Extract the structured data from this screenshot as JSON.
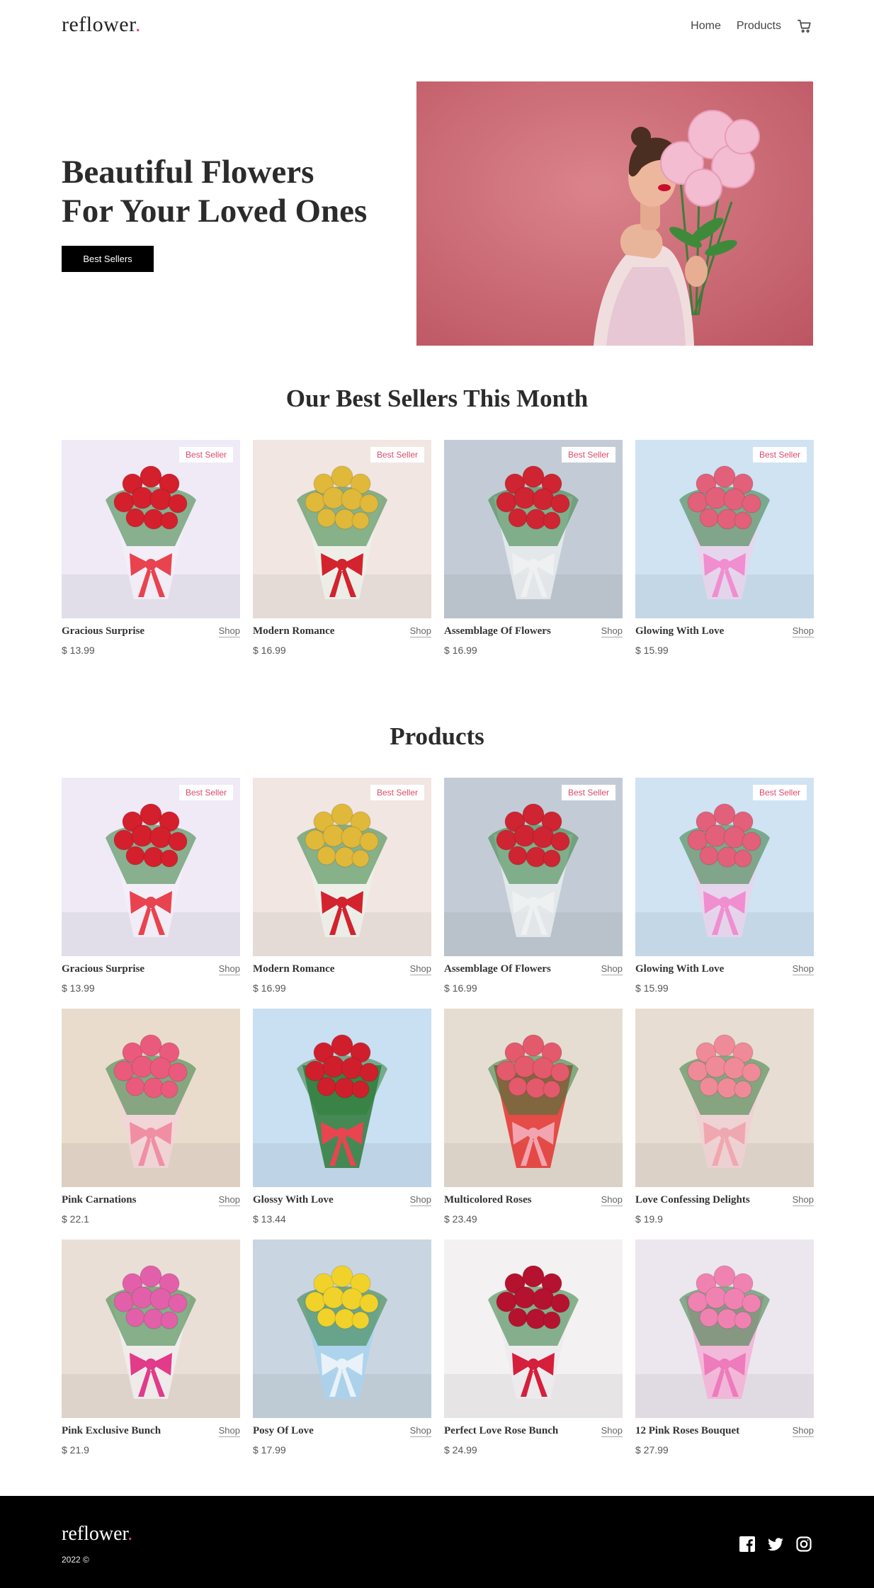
{
  "header": {
    "logo_text": "reflower",
    "logo_dot": ".",
    "nav": {
      "home": "Home",
      "products": "Products"
    }
  },
  "hero": {
    "title_line1": "Beautiful Flowers",
    "title_line2": "For Your Loved Ones",
    "button": "Best Sellers"
  },
  "best_sellers": {
    "title": "Our Best Sellers This Month",
    "items": [
      {
        "name": "Gracious Surprise",
        "price": "$ 13.99",
        "shop": "Shop",
        "badge": "Best Seller",
        "bg": "#efeaf6",
        "flower": "#d41f2c",
        "wrap": "#f3eef7",
        "ribbon": "#e8434f"
      },
      {
        "name": "Modern Romance",
        "price": "$ 16.99",
        "shop": "Shop",
        "badge": "Best Seller",
        "bg": "#f1e6e2",
        "flower": "#e0b83a",
        "wrap": "#eef0ea",
        "ribbon": "#d2232e"
      },
      {
        "name": "Assemblage Of Flowers",
        "price": "$ 16.99",
        "shop": "Shop",
        "badge": "Best Seller",
        "bg": "#c3ccd6",
        "flower": "#cf2431",
        "wrap": "#e9ecef",
        "ribbon": "#eef0f2"
      },
      {
        "name": "Glowing With Love",
        "price": "$ 15.99",
        "shop": "Shop",
        "badge": "Best Seller",
        "bg": "#cfe3f3",
        "flower": "#e2607a",
        "wrap": "#e9d3ec",
        "ribbon": "#f08ed0"
      }
    ]
  },
  "products": {
    "title": "Products",
    "items": [
      {
        "name": "Gracious Surprise",
        "price": "$ 13.99",
        "shop": "Shop",
        "badge": "Best Seller",
        "bg": "#efeaf6",
        "flower": "#d41f2c",
        "wrap": "#f3eef7",
        "ribbon": "#e8434f"
      },
      {
        "name": "Modern Romance",
        "price": "$ 16.99",
        "shop": "Shop",
        "badge": "Best Seller",
        "bg": "#f1e6e2",
        "flower": "#e0b83a",
        "wrap": "#eef0ea",
        "ribbon": "#d2232e"
      },
      {
        "name": "Assemblage Of Flowers",
        "price": "$ 16.99",
        "shop": "Shop",
        "badge": "Best Seller",
        "bg": "#c3ccd6",
        "flower": "#cf2431",
        "wrap": "#e9ecef",
        "ribbon": "#eef0f2"
      },
      {
        "name": "Glowing With Love",
        "price": "$ 15.99",
        "shop": "Shop",
        "badge": "Best Seller",
        "bg": "#cfe3f3",
        "flower": "#e2607a",
        "wrap": "#e9d3ec",
        "ribbon": "#f08ed0"
      },
      {
        "name": "Pink Carnations",
        "price": "$ 22.1",
        "shop": "Shop",
        "badge": "",
        "bg": "#e9dccd",
        "flower": "#ea5a7c",
        "wrap": "#f2d4d8",
        "ribbon": "#f08fa4"
      },
      {
        "name": "Glossy With Love",
        "price": "$ 13.44",
        "shop": "Shop",
        "badge": "",
        "bg": "#c9dff2",
        "flower": "#d01f2c",
        "wrap": "#2f7a3a",
        "ribbon": "#e84550"
      },
      {
        "name": "Multicolored Roses",
        "price": "$ 23.49",
        "shop": "Shop",
        "badge": "",
        "bg": "#e6ddd2",
        "flower": "#e25a6c",
        "wrap": "#e4322f",
        "ribbon": "#f2a4b0"
      },
      {
        "name": "Love Confessing Delights",
        "price": "$ 19.9",
        "shop": "Shop",
        "badge": "",
        "bg": "#e8ddd2",
        "flower": "#ef8a98",
        "wrap": "#f0d0d3",
        "ribbon": "#f0a8b0"
      },
      {
        "name": "Pink Exclusive Bunch",
        "price": "$ 21.9",
        "shop": "Shop",
        "badge": "",
        "bg": "#eadfd6",
        "flower": "#e260a9",
        "wrap": "#f1eef0",
        "ribbon": "#e13b8a"
      },
      {
        "name": "Posy Of Love",
        "price": "$ 17.99",
        "shop": "Shop",
        "badge": "",
        "bg": "#c9d6e1",
        "flower": "#f1d22a",
        "wrap": "#a9d2ee",
        "ribbon": "#e9f2f8"
      },
      {
        "name": "Perfect Love Rose Bunch",
        "price": "$ 24.99",
        "shop": "Shop",
        "badge": "",
        "bg": "#f3f1f2",
        "flower": "#b5122f",
        "wrap": "#ecebee",
        "ribbon": "#d61f3a"
      },
      {
        "name": "12 Pink Roses Bouquet",
        "price": "$ 27.99",
        "shop": "Shop",
        "badge": "",
        "bg": "#ece7ef",
        "flower": "#f082b2",
        "wrap": "#f3b0d6",
        "ribbon": "#ee7bbb"
      }
    ]
  },
  "footer": {
    "logo_text": "reflower",
    "logo_dot": ".",
    "copyright": "2022 ©"
  },
  "icons": {
    "cart": "cart-icon",
    "facebook": "facebook-icon",
    "twitter": "twitter-icon",
    "instagram": "instagram-icon"
  }
}
